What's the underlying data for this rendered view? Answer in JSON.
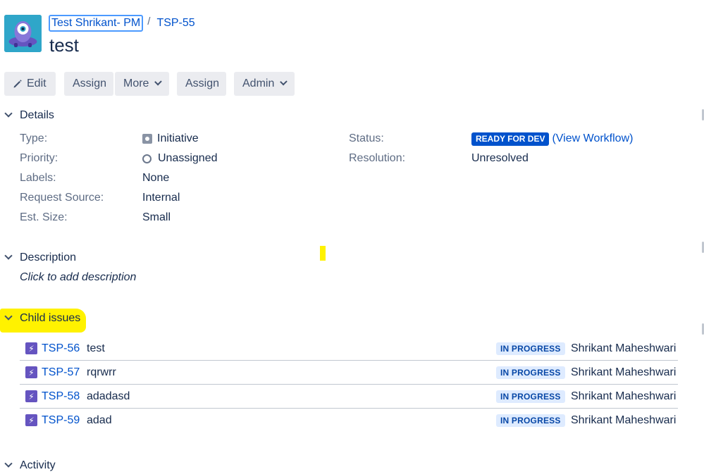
{
  "breadcrumb": {
    "project": "Test Shrikant- PM",
    "separator": "/",
    "issue_key": "TSP-55"
  },
  "issue": {
    "title": "test"
  },
  "toolbar": {
    "edit": "Edit",
    "assign": "Assign",
    "more": "More",
    "assign2": "Assign",
    "admin": "Admin"
  },
  "details": {
    "heading": "Details",
    "type_label": "Type:",
    "type_value": "Initiative",
    "priority_label": "Priority:",
    "priority_value": "Unassigned",
    "labels_label": "Labels:",
    "labels_value": "None",
    "request_source_label": "Request Source:",
    "request_source_value": "Internal",
    "est_size_label": "Est. Size:",
    "est_size_value": "Small",
    "status_label": "Status:",
    "status_value": "READY FOR DEV",
    "view_workflow": "(View Workflow)",
    "resolution_label": "Resolution:",
    "resolution_value": "Unresolved"
  },
  "description": {
    "heading": "Description",
    "placeholder": "Click to add description"
  },
  "child_issues": {
    "heading": "Child issues",
    "rows": [
      {
        "key": "TSP-56",
        "summary": "test",
        "status": "IN PROGRESS",
        "assignee": "Shrikant Maheshwari"
      },
      {
        "key": "TSP-57",
        "summary": "rqrwrr",
        "status": "IN PROGRESS",
        "assignee": "Shrikant Maheshwari"
      },
      {
        "key": "TSP-58",
        "summary": "adadasd",
        "status": "IN PROGRESS",
        "assignee": "Shrikant Maheshwari"
      },
      {
        "key": "TSP-59",
        "summary": "adad",
        "status": "IN PROGRESS",
        "assignee": "Shrikant Maheshwari"
      }
    ]
  },
  "activity": {
    "heading": "Activity"
  },
  "colors": {
    "link": "#0052cc",
    "status_blue": "#0052cc",
    "in_progress_bg": "#deebff",
    "highlight": "#fff200",
    "story_purple": "#6554c0",
    "avatar_bg": "#2fa6c9"
  },
  "icons": {
    "edit": "pencil-icon",
    "type": "initiative-icon",
    "priority": "priority-circle-icon",
    "story": "story-bolt-icon",
    "dropdown": "chevron-down-icon",
    "collapse": "chevron-down-icon"
  }
}
